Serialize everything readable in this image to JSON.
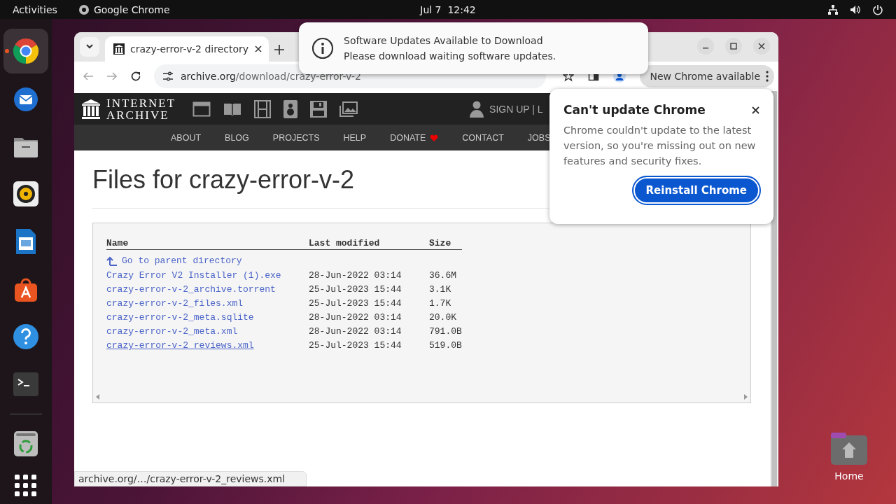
{
  "top_bar": {
    "activities": "Activities",
    "app_name": "Google Chrome",
    "clock": "Jul 7  12:42"
  },
  "dock": {
    "apps": [
      {
        "kind": "chrome",
        "running": true
      },
      {
        "kind": "mail",
        "running": false
      },
      {
        "kind": "files",
        "running": false
      },
      {
        "kind": "music",
        "running": false
      },
      {
        "kind": "writer",
        "running": false
      },
      {
        "kind": "store",
        "running": false
      },
      {
        "kind": "help",
        "running": false
      },
      {
        "kind": "terminal",
        "running": false
      }
    ],
    "extras": [
      {
        "kind": "trash",
        "running": false
      }
    ]
  },
  "notification": {
    "title": "Software Updates Available to Download",
    "body": "Please download waiting software updates."
  },
  "browser": {
    "tab": {
      "title": "crazy-error-v-2 directory"
    },
    "back_disabled": true,
    "forward_disabled": true,
    "address": {
      "host": "archive.org",
      "path": "/download/crazy-error-v-2"
    },
    "update_chip": "New Chrome available",
    "status_url": "archive.org/…/crazy-error-v-2_reviews.xml"
  },
  "page": {
    "logo_lines": [
      "INTERNET",
      "ARCHIVE"
    ],
    "account": "SIGN UP | L",
    "nav": [
      {
        "label": "ABOUT",
        "heart": false
      },
      {
        "label": "BLOG",
        "heart": false
      },
      {
        "label": "PROJECTS",
        "heart": false
      },
      {
        "label": "HELP",
        "heart": false
      },
      {
        "label": "DONATE",
        "heart": true
      },
      {
        "label": "CONTACT",
        "heart": false
      },
      {
        "label": "JOBS",
        "heart": false
      }
    ],
    "heading": "Files for crazy-error-v-2",
    "table": {
      "columns": [
        "Name",
        "Last modified",
        "Size"
      ],
      "parent_link": "Go to parent directory",
      "rows": [
        {
          "name": "Crazy Error V2 Installer (1).exe",
          "modified": "28-Jun-2022 03:14",
          "size": "36.6M",
          "hovered": false
        },
        {
          "name": "crazy-error-v-2_archive.torrent",
          "modified": "25-Jul-2023 15:44",
          "size": "3.1K",
          "hovered": false
        },
        {
          "name": "crazy-error-v-2_files.xml",
          "modified": "25-Jul-2023 15:44",
          "size": "1.7K",
          "hovered": false
        },
        {
          "name": "crazy-error-v-2_meta.sqlite",
          "modified": "28-Jun-2022 03:14",
          "size": "20.0K",
          "hovered": false
        },
        {
          "name": "crazy-error-v-2_meta.xml",
          "modified": "28-Jun-2022 03:14",
          "size": "791.0B",
          "hovered": false
        },
        {
          "name": "crazy-error-v-2_reviews.xml",
          "modified": "25-Jul-2023 15:44",
          "size": "519.0B",
          "hovered": true
        }
      ]
    }
  },
  "popup": {
    "title": "Can't update Chrome",
    "body": "Chrome couldn't update to the latest version, so you're missing out on new features and security fixes.",
    "button": "Reinstall Chrome"
  },
  "desktop_icons": [
    {
      "label": "Home"
    }
  ]
}
